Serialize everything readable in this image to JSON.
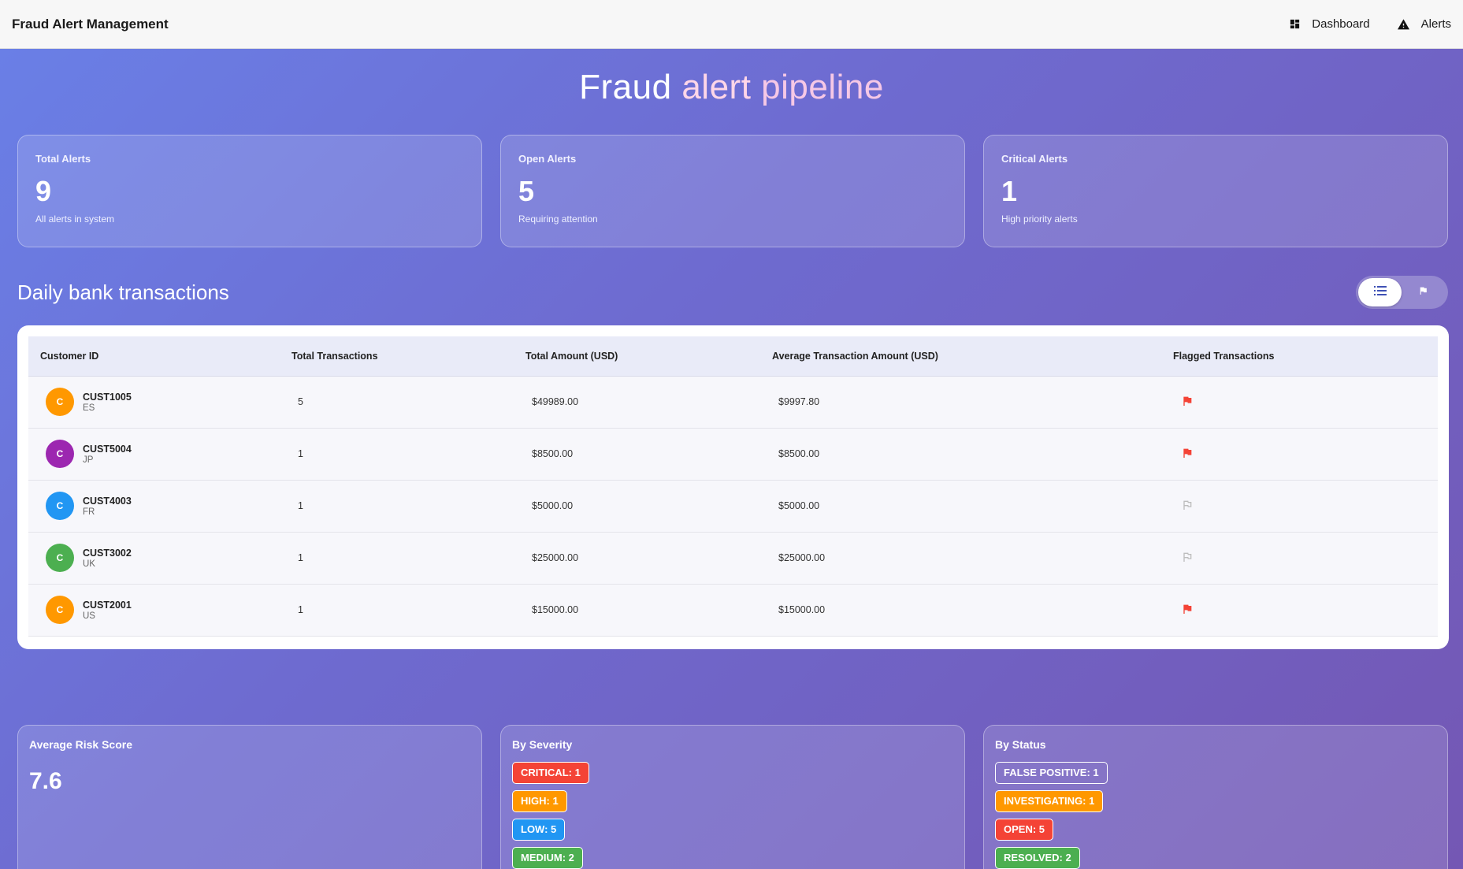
{
  "app": {
    "title": "Fraud Alert Management"
  },
  "nav": {
    "dashboard": {
      "label": "Dashboard",
      "icon": "dashboard-icon"
    },
    "alerts": {
      "label": "Alerts",
      "icon": "warning-icon"
    }
  },
  "hero": {
    "word1": "Fraud",
    "word2": "alert",
    "word3": "pipeline"
  },
  "stats": [
    {
      "label": "Total Alerts",
      "value": "9",
      "sub": "All alerts in system"
    },
    {
      "label": "Open Alerts",
      "value": "5",
      "sub": "Requiring attention"
    },
    {
      "label": "Critical Alerts",
      "value": "1",
      "sub": "High priority alerts"
    }
  ],
  "section": {
    "title": "Daily bank transactions"
  },
  "view_toggle": {
    "list_icon": "list-icon",
    "flag_icon": "flag-icon",
    "active": "list"
  },
  "table": {
    "headers": [
      "Customer ID",
      "Total Transactions",
      "Total Amount (USD)",
      "Average Transaction Amount (USD)",
      "Flagged Transactions"
    ],
    "rows": [
      {
        "avatar": "C",
        "avatar_color": "#ff9800",
        "id": "CUST1005",
        "country": "ES",
        "total": "5",
        "amount": "$49989.00",
        "avg": "$9997.80",
        "flagged": true
      },
      {
        "avatar": "C",
        "avatar_color": "#9c27b0",
        "id": "CUST5004",
        "country": "JP",
        "total": "1",
        "amount": "$8500.00",
        "avg": "$8500.00",
        "flagged": true
      },
      {
        "avatar": "C",
        "avatar_color": "#2196f3",
        "id": "CUST4003",
        "country": "FR",
        "total": "1",
        "amount": "$5000.00",
        "avg": "$5000.00",
        "flagged": false
      },
      {
        "avatar": "C",
        "avatar_color": "#4caf50",
        "id": "CUST3002",
        "country": "UK",
        "total": "1",
        "amount": "$25000.00",
        "avg": "$25000.00",
        "flagged": false
      },
      {
        "avatar": "C",
        "avatar_color": "#ff9800",
        "id": "CUST2001",
        "country": "US",
        "total": "1",
        "amount": "$15000.00",
        "avg": "$15000.00",
        "flagged": true
      }
    ]
  },
  "risk": {
    "label": "Average Risk Score",
    "value": "7.6"
  },
  "severity": {
    "label": "By Severity",
    "items": [
      {
        "text": "CRITICAL: 1",
        "color": "#f44336"
      },
      {
        "text": "HIGH: 1",
        "color": "#ff9800"
      },
      {
        "text": "LOW: 5",
        "color": "#2196f3"
      },
      {
        "text": "MEDIUM: 2",
        "color": "#4caf50"
      }
    ]
  },
  "status": {
    "label": "By Status",
    "items": [
      {
        "text": "FALSE POSITIVE: 1",
        "color": "transparent"
      },
      {
        "text": "INVESTIGATING: 1",
        "color": "#ff9800"
      },
      {
        "text": "OPEN: 5",
        "color": "#f44336"
      },
      {
        "text": "RESOLVED: 2",
        "color": "#4caf50"
      }
    ]
  },
  "colors": {
    "flag_active": "#f44336",
    "flag_inactive": "#bdbdbd",
    "toggle_active_icon": "#3f51b5"
  }
}
